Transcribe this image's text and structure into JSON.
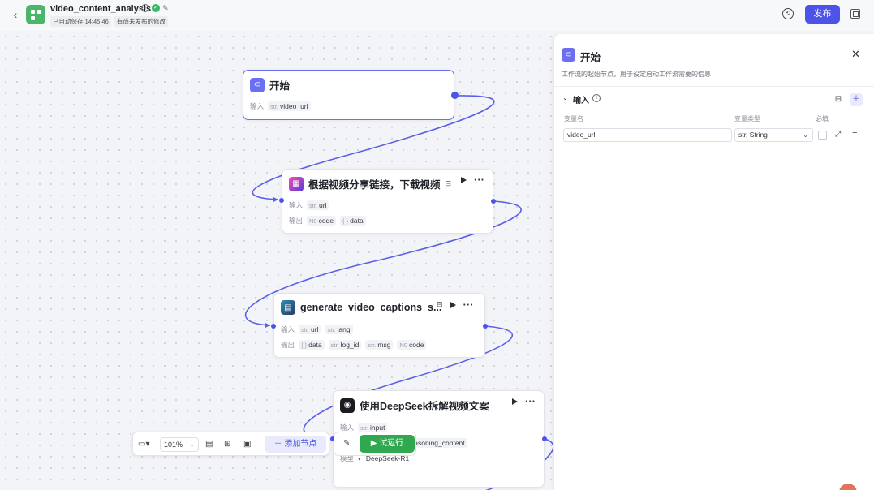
{
  "header": {
    "title": "video_content_analysis",
    "autosave": "已自动保存 14:45:46",
    "unpublished": "有尚未发布的修改",
    "publish_label": "发布"
  },
  "nodes": {
    "start": {
      "title": "开始",
      "input_label": "输入",
      "inputs": [
        {
          "type": "str.",
          "name": "video_url"
        }
      ]
    },
    "download": {
      "title": "根据视频分享链接，下载视频",
      "input_label": "输入",
      "output_label": "输出",
      "inputs": [
        {
          "type": "str.",
          "name": "url"
        }
      ],
      "outputs": [
        {
          "type": "N0",
          "name": "code"
        },
        {
          "type": "{ }",
          "name": "data"
        }
      ]
    },
    "captions": {
      "title": "generate_video_captions_s...",
      "input_label": "输入",
      "output_label": "输出",
      "inputs": [
        {
          "type": "str.",
          "name": "url"
        },
        {
          "type": "str.",
          "name": "lang"
        }
      ],
      "outputs": [
        {
          "type": "{ }",
          "name": "data"
        },
        {
          "type": "str.",
          "name": "log_id"
        },
        {
          "type": "str.",
          "name": "msg"
        },
        {
          "type": "N0",
          "name": "code"
        }
      ]
    },
    "deepseek": {
      "title": "使用DeepSeek拆解视频文案",
      "input_label": "输入",
      "output_label": "输出",
      "model_label": "模型",
      "inputs": [
        {
          "type": "str.",
          "name": "input"
        }
      ],
      "outputs": [
        {
          "type": "str.",
          "name": "output"
        },
        {
          "type": "str.",
          "name": "reasoning_content"
        }
      ],
      "model": "DeepSeek-R1"
    }
  },
  "toolbar": {
    "zoom": "101%",
    "add_node_label": "添加节点",
    "run_label": "试运行"
  },
  "panel": {
    "title": "开始",
    "description": "工作流的起始节点，用于设定启动工作流需要的信息",
    "section_title": "输入",
    "col_name": "变量名",
    "col_type": "变量类型",
    "col_required": "必填",
    "variables": [
      {
        "name": "video_url",
        "type": "str. String"
      }
    ]
  },
  "colors": {
    "accent": "#4d53e8",
    "run": "#2fa84f",
    "edge": "#5b60e6"
  }
}
